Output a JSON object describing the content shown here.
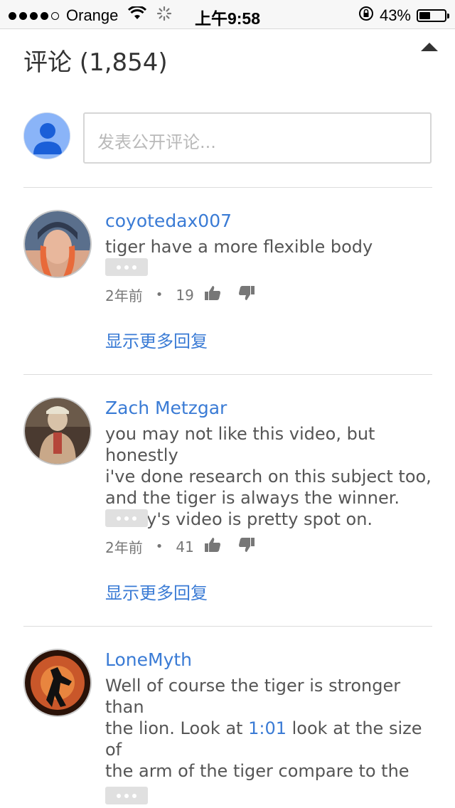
{
  "status_bar": {
    "carrier": "Orange",
    "time": "上午9:58",
    "battery_percent": "43%",
    "battery_level": 0.43,
    "signal_dots_filled": 4,
    "icons": [
      "wifi-icon",
      "activity-spinner-icon",
      "rotation-lock-icon",
      "battery-icon"
    ]
  },
  "header": {
    "title": "评论 (1,854)",
    "collapse_icon": "caret-up-icon"
  },
  "composer": {
    "placeholder": "发表公开评论..."
  },
  "comments": [
    {
      "author": "coyotedax007",
      "text": "tiger have a more flexible body",
      "age": "2年前",
      "separator": "•",
      "likes": "19",
      "show_replies": "显示更多回复"
    },
    {
      "author": "Zach Metzgar",
      "text": "you may not like this video, but honestly\ni've done research on this subject too,\nand the tiger is always the winner.\nLenny's video is pretty spot on.",
      "age": "2年前",
      "separator": "•",
      "likes": "41",
      "show_replies": "显示更多回复"
    },
    {
      "author": "LoneMyth",
      "text_before": "Well of course the tiger is stronger than\nthe lion. Look at ",
      "timestamp_link": "1:01",
      "text_after": " look at the size of\nthe arm of the tiger compare to the\nLion. The reason Tiger is stronger\nbecause Tigers have to Hunt on there"
    }
  ],
  "colors": {
    "link_blue": "#3a7bd5",
    "text_gray": "#555555",
    "divider": "#dcdcdc",
    "avatar_blue": "#8ab4f8"
  }
}
